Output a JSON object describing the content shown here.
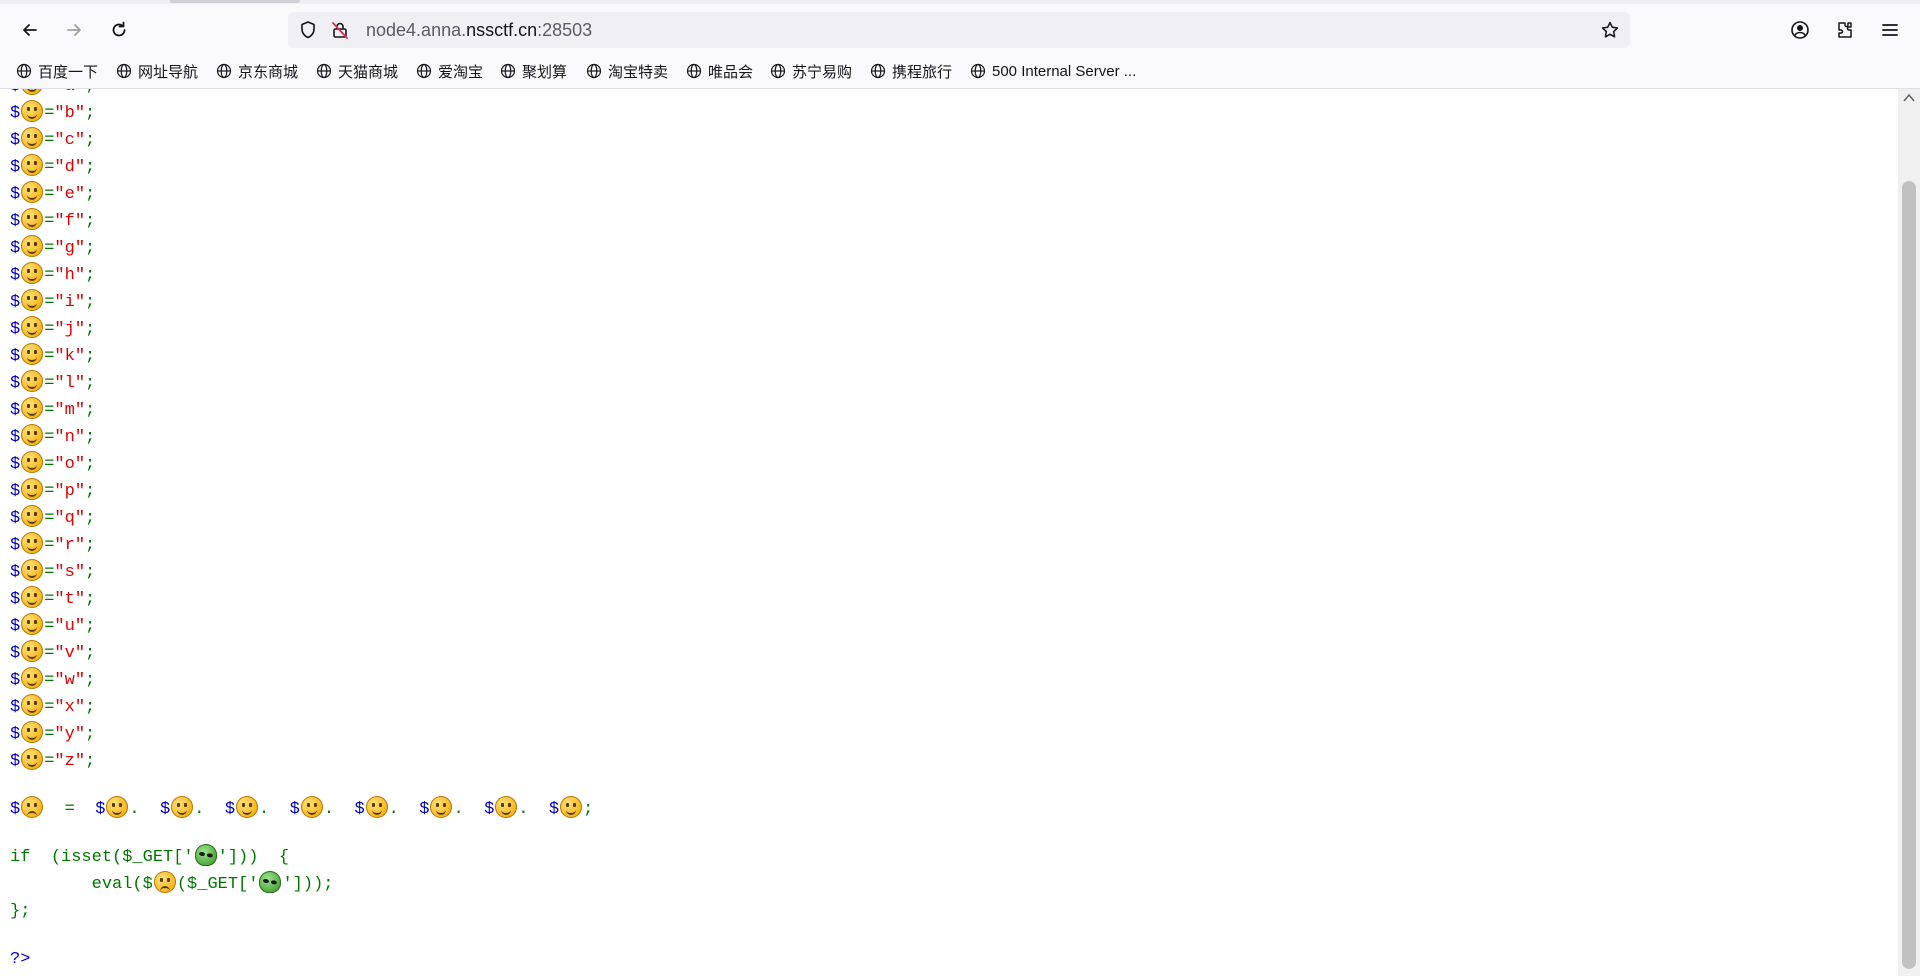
{
  "browser": {
    "url_prefix": "node4.anna.",
    "url_domain": "nssctf.cn",
    "url_suffix": ":28503",
    "icons": [
      "back-icon",
      "forward-icon",
      "reload-icon",
      "shield-icon",
      "insecure-lock-icon",
      "bookmark-star-icon",
      "account-icon",
      "extensions-icon",
      "menu-icon"
    ]
  },
  "bookmarks": [
    {
      "label": "百度一下"
    },
    {
      "label": "网址导航"
    },
    {
      "label": "京东商城"
    },
    {
      "label": "天猫商城"
    },
    {
      "label": "爱淘宝"
    },
    {
      "label": "聚划算"
    },
    {
      "label": "淘宝特卖"
    },
    {
      "label": "唯品会"
    },
    {
      "label": "苏宁易购"
    },
    {
      "label": "携程旅行"
    },
    {
      "label": "500 Internal Server ..."
    }
  ],
  "code": {
    "assignments": [
      {
        "letter": "a"
      },
      {
        "letter": "b"
      },
      {
        "letter": "c"
      },
      {
        "letter": "d"
      },
      {
        "letter": "e"
      },
      {
        "letter": "f"
      },
      {
        "letter": "g"
      },
      {
        "letter": "h"
      },
      {
        "letter": "i"
      },
      {
        "letter": "j"
      },
      {
        "letter": "k"
      },
      {
        "letter": "l"
      },
      {
        "letter": "m"
      },
      {
        "letter": "n"
      },
      {
        "letter": "o"
      },
      {
        "letter": "p"
      },
      {
        "letter": "q"
      },
      {
        "letter": "r"
      },
      {
        "letter": "s"
      },
      {
        "letter": "t"
      },
      {
        "letter": "u"
      },
      {
        "letter": "v"
      },
      {
        "letter": "w"
      },
      {
        "letter": "x"
      },
      {
        "letter": "y"
      },
      {
        "letter": "z"
      }
    ],
    "concat_count": 8,
    "if_keyword": "if",
    "isset_open": "(isset($_GET['",
    "isset_close": "']))",
    "brace_open": "{",
    "eval_open": "eval($",
    "eval_mid": "($_GET['",
    "eval_close": "']));",
    "brace_close": "};",
    "php_close": "?>"
  },
  "colors": {
    "php_default": "#0000BB",
    "php_string": "#DD0000",
    "php_keyword": "#007700"
  }
}
